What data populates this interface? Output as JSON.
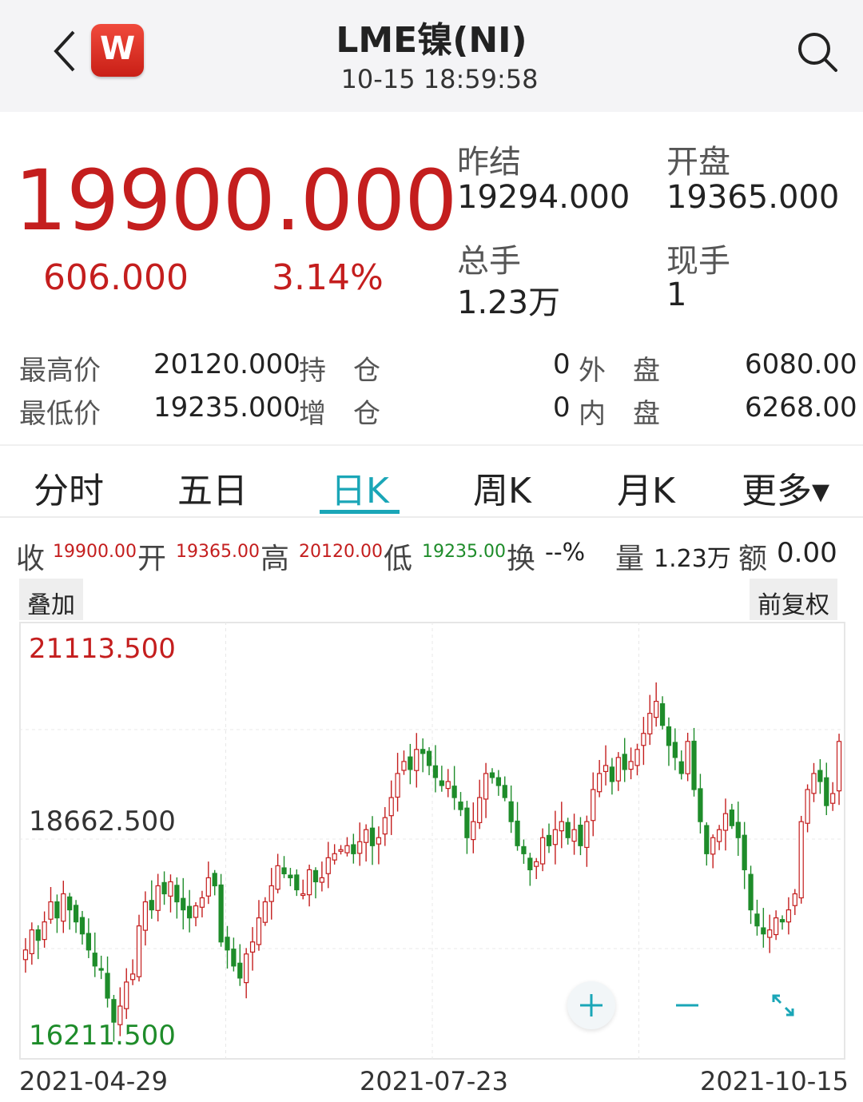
{
  "header": {
    "title": "LME镍(NI)",
    "datetime": "10-15 18:59:58",
    "logo_letter": "W",
    "back_icon": "chevron-left-icon",
    "search_icon": "search-icon"
  },
  "quote": {
    "price": "19900.000",
    "change": "606.000",
    "change_pct": "3.14%",
    "prev_settle_label": "昨结",
    "prev_settle": "19294.000",
    "open_label": "开盘",
    "open": "19365.000",
    "volume_label": "总手",
    "volume": "1.23万",
    "last_vol_label": "现手",
    "last_vol": "1"
  },
  "stats": {
    "high_label": "最高价",
    "high": "20120.000",
    "low_label": "最低价",
    "low": "19235.000",
    "oi_label": "持　仓",
    "oi": "0",
    "oi_chg_label": "增　仓",
    "oi_chg": "0",
    "outer_label": "外　盘",
    "outer": "6080.00",
    "inner_label": "内　盘",
    "inner": "6268.00"
  },
  "tabs": [
    {
      "label": "分时"
    },
    {
      "label": "五日"
    },
    {
      "label": "日K",
      "active": true
    },
    {
      "label": "周K"
    },
    {
      "label": "月K"
    },
    {
      "label": "更多▾"
    }
  ],
  "ohlc": {
    "close_label": "收",
    "close": "19900.00",
    "open_label": "开",
    "open": "19365.00",
    "high_label": "高",
    "high": "20120.00",
    "low_label": "低",
    "low": "19235.00",
    "turnover_label": "换",
    "turnover": "--%",
    "vol_label": "量",
    "vol": "1.23万",
    "amount_label": "额",
    "amount": "0.00"
  },
  "chips": {
    "overlay": "叠加",
    "adjust": "前复权"
  },
  "colors": {
    "up": "#c41e1e",
    "down": "#1e8c2a",
    "accent": "#1aa6b7"
  },
  "chart_data": {
    "type": "candlestick",
    "y_labels": [
      "21113.500",
      "18662.500",
      "16211.500"
    ],
    "ylim": [
      16211.5,
      21113.5
    ],
    "x_labels": [
      "2021-04-29",
      "2021-07-23",
      "2021-10-15"
    ],
    "close_series": [
      17300,
      17550,
      17420,
      17650,
      17900,
      17700,
      18000,
      17800,
      17650,
      17500,
      17300,
      17100,
      17050,
      16700,
      16400,
      16600,
      16900,
      17000,
      17600,
      17900,
      17800,
      18100,
      18000,
      18150,
      17900,
      17800,
      17700,
      17850,
      17950,
      18200,
      18100,
      17400,
      17300,
      17100,
      16950,
      17250,
      17400,
      17700,
      17900,
      18100,
      18350,
      18250,
      18200,
      18050,
      18000,
      18300,
      18150,
      18200,
      18450,
      18500,
      18550,
      18600,
      18500,
      18650,
      18800,
      18600,
      18700,
      18950,
      19200,
      19500,
      19650,
      19550,
      19800,
      19750,
      19600,
      19450,
      19350,
      19400,
      19200,
      19050,
      18700,
      18900,
      19200,
      19500,
      19450,
      19350,
      19200,
      18900,
      18600,
      18500,
      18300,
      18400,
      18700,
      18600,
      18800,
      18900,
      18700,
      18800,
      18600,
      18900,
      19300,
      19500,
      19600,
      19400,
      19700,
      19550,
      19650,
      19800,
      20000,
      20250,
      20400,
      20100,
      19850,
      19700,
      19500,
      19900,
      19300,
      18900,
      18500,
      18700,
      18800,
      19000,
      18850,
      18700,
      18300,
      17800,
      17600,
      17500,
      17550,
      17700,
      17650,
      17800,
      18000,
      18900,
      19300,
      19500,
      19400,
      19100,
      19250,
      19900
    ]
  },
  "chart_controls": {
    "zoom_in": "+",
    "zoom_out": "—",
    "fullscreen_icon": "expand-icon"
  }
}
